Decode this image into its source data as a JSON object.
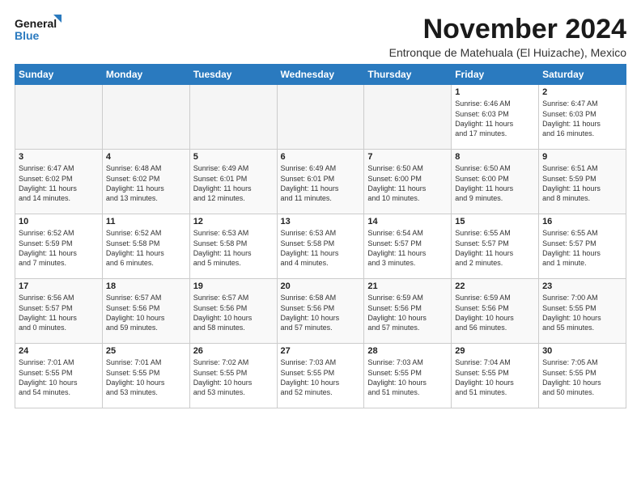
{
  "header": {
    "logo_line1": "General",
    "logo_line2": "Blue",
    "month": "November 2024",
    "location": "Entronque de Matehuala (El Huizache), Mexico"
  },
  "weekdays": [
    "Sunday",
    "Monday",
    "Tuesday",
    "Wednesday",
    "Thursday",
    "Friday",
    "Saturday"
  ],
  "weeks": [
    [
      {
        "day": "",
        "info": ""
      },
      {
        "day": "",
        "info": ""
      },
      {
        "day": "",
        "info": ""
      },
      {
        "day": "",
        "info": ""
      },
      {
        "day": "",
        "info": ""
      },
      {
        "day": "1",
        "info": "Sunrise: 6:46 AM\nSunset: 6:03 PM\nDaylight: 11 hours\nand 17 minutes."
      },
      {
        "day": "2",
        "info": "Sunrise: 6:47 AM\nSunset: 6:03 PM\nDaylight: 11 hours\nand 16 minutes."
      }
    ],
    [
      {
        "day": "3",
        "info": "Sunrise: 6:47 AM\nSunset: 6:02 PM\nDaylight: 11 hours\nand 14 minutes."
      },
      {
        "day": "4",
        "info": "Sunrise: 6:48 AM\nSunset: 6:02 PM\nDaylight: 11 hours\nand 13 minutes."
      },
      {
        "day": "5",
        "info": "Sunrise: 6:49 AM\nSunset: 6:01 PM\nDaylight: 11 hours\nand 12 minutes."
      },
      {
        "day": "6",
        "info": "Sunrise: 6:49 AM\nSunset: 6:01 PM\nDaylight: 11 hours\nand 11 minutes."
      },
      {
        "day": "7",
        "info": "Sunrise: 6:50 AM\nSunset: 6:00 PM\nDaylight: 11 hours\nand 10 minutes."
      },
      {
        "day": "8",
        "info": "Sunrise: 6:50 AM\nSunset: 6:00 PM\nDaylight: 11 hours\nand 9 minutes."
      },
      {
        "day": "9",
        "info": "Sunrise: 6:51 AM\nSunset: 5:59 PM\nDaylight: 11 hours\nand 8 minutes."
      }
    ],
    [
      {
        "day": "10",
        "info": "Sunrise: 6:52 AM\nSunset: 5:59 PM\nDaylight: 11 hours\nand 7 minutes."
      },
      {
        "day": "11",
        "info": "Sunrise: 6:52 AM\nSunset: 5:58 PM\nDaylight: 11 hours\nand 6 minutes."
      },
      {
        "day": "12",
        "info": "Sunrise: 6:53 AM\nSunset: 5:58 PM\nDaylight: 11 hours\nand 5 minutes."
      },
      {
        "day": "13",
        "info": "Sunrise: 6:53 AM\nSunset: 5:58 PM\nDaylight: 11 hours\nand 4 minutes."
      },
      {
        "day": "14",
        "info": "Sunrise: 6:54 AM\nSunset: 5:57 PM\nDaylight: 11 hours\nand 3 minutes."
      },
      {
        "day": "15",
        "info": "Sunrise: 6:55 AM\nSunset: 5:57 PM\nDaylight: 11 hours\nand 2 minutes."
      },
      {
        "day": "16",
        "info": "Sunrise: 6:55 AM\nSunset: 5:57 PM\nDaylight: 11 hours\nand 1 minute."
      }
    ],
    [
      {
        "day": "17",
        "info": "Sunrise: 6:56 AM\nSunset: 5:57 PM\nDaylight: 11 hours\nand 0 minutes."
      },
      {
        "day": "18",
        "info": "Sunrise: 6:57 AM\nSunset: 5:56 PM\nDaylight: 10 hours\nand 59 minutes."
      },
      {
        "day": "19",
        "info": "Sunrise: 6:57 AM\nSunset: 5:56 PM\nDaylight: 10 hours\nand 58 minutes."
      },
      {
        "day": "20",
        "info": "Sunrise: 6:58 AM\nSunset: 5:56 PM\nDaylight: 10 hours\nand 57 minutes."
      },
      {
        "day": "21",
        "info": "Sunrise: 6:59 AM\nSunset: 5:56 PM\nDaylight: 10 hours\nand 57 minutes."
      },
      {
        "day": "22",
        "info": "Sunrise: 6:59 AM\nSunset: 5:56 PM\nDaylight: 10 hours\nand 56 minutes."
      },
      {
        "day": "23",
        "info": "Sunrise: 7:00 AM\nSunset: 5:55 PM\nDaylight: 10 hours\nand 55 minutes."
      }
    ],
    [
      {
        "day": "24",
        "info": "Sunrise: 7:01 AM\nSunset: 5:55 PM\nDaylight: 10 hours\nand 54 minutes."
      },
      {
        "day": "25",
        "info": "Sunrise: 7:01 AM\nSunset: 5:55 PM\nDaylight: 10 hours\nand 53 minutes."
      },
      {
        "day": "26",
        "info": "Sunrise: 7:02 AM\nSunset: 5:55 PM\nDaylight: 10 hours\nand 53 minutes."
      },
      {
        "day": "27",
        "info": "Sunrise: 7:03 AM\nSunset: 5:55 PM\nDaylight: 10 hours\nand 52 minutes."
      },
      {
        "day": "28",
        "info": "Sunrise: 7:03 AM\nSunset: 5:55 PM\nDaylight: 10 hours\nand 51 minutes."
      },
      {
        "day": "29",
        "info": "Sunrise: 7:04 AM\nSunset: 5:55 PM\nDaylight: 10 hours\nand 51 minutes."
      },
      {
        "day": "30",
        "info": "Sunrise: 7:05 AM\nSunset: 5:55 PM\nDaylight: 10 hours\nand 50 minutes."
      }
    ]
  ]
}
